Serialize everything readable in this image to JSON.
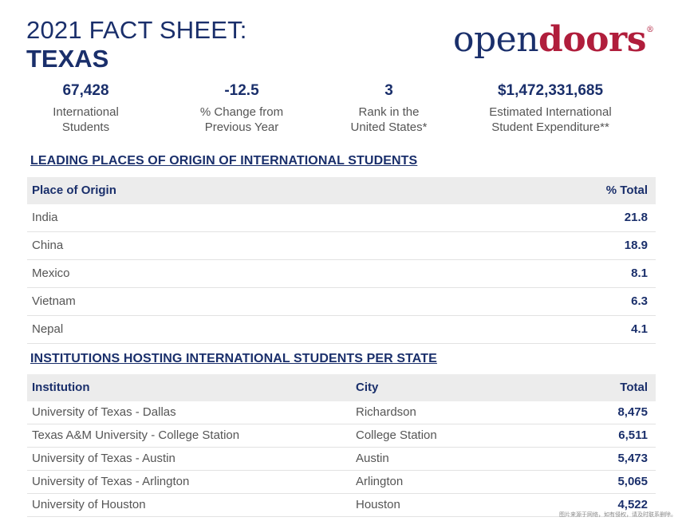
{
  "header": {
    "title_line1": "2021 FACT SHEET:",
    "title_line2": "TEXAS",
    "logo": {
      "part1": "open",
      "part2": "doors",
      "mark": "®"
    }
  },
  "stats": [
    {
      "value": "67,428",
      "label1": "International",
      "label2": "Students"
    },
    {
      "value": "-12.5",
      "label1": "% Change from",
      "label2": "Previous Year"
    },
    {
      "value": "3",
      "label1": "Rank in the",
      "label2": "United States*"
    },
    {
      "value": "$1,472,331,685",
      "label1": "Estimated International",
      "label2": "Student Expenditure**"
    }
  ],
  "origins": {
    "heading": "LEADING PLACES OF ORIGIN OF INTERNATIONAL STUDENTS",
    "col_place": "Place of Origin",
    "col_total": "% Total",
    "rows": [
      {
        "place": "India",
        "total": "21.8"
      },
      {
        "place": "China",
        "total": "18.9"
      },
      {
        "place": "Mexico",
        "total": "8.1"
      },
      {
        "place": "Vietnam",
        "total": "6.3"
      },
      {
        "place": "Nepal",
        "total": "4.1"
      }
    ]
  },
  "institutions": {
    "heading": "INSTITUTIONS HOSTING INTERNATIONAL STUDENTS PER STATE",
    "col_institution": "Institution",
    "col_city": "City",
    "col_total": "Total",
    "rows": [
      {
        "name": "University of Texas - Dallas",
        "city": "Richardson",
        "total": "8,475"
      },
      {
        "name": "Texas A&M University - College Station",
        "city": "College Station",
        "total": "6,511"
      },
      {
        "name": "University of Texas - Austin",
        "city": "Austin",
        "total": "5,473"
      },
      {
        "name": "University of Texas - Arlington",
        "city": "Arlington",
        "total": "5,065"
      },
      {
        "name": "University of Houston",
        "city": "Houston",
        "total": "4,522"
      }
    ]
  },
  "watermark": "图片来源于网络，如有侵权，请及时联系删除。",
  "colors": {
    "navy": "#1a2f6b",
    "brand_red": "#b01e3c",
    "header_bg": "#ececec"
  }
}
